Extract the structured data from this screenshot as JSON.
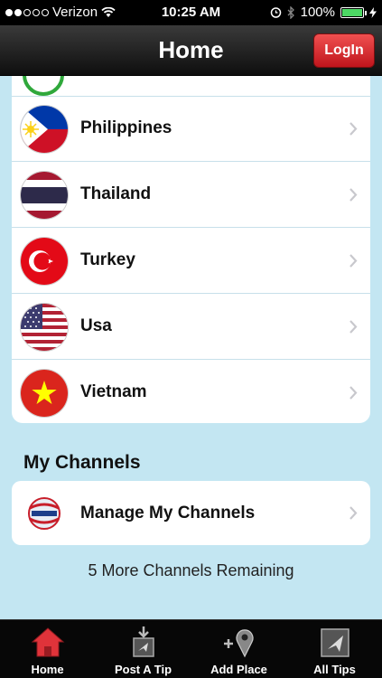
{
  "status_bar": {
    "carrier": "Verizon",
    "signal_bars": 2,
    "time": "10:25 AM",
    "battery": "100%"
  },
  "nav": {
    "title": "Home",
    "login_label": "LogIn"
  },
  "countries": [
    {
      "label": "Philippines",
      "flag": "philippines-flag-icon"
    },
    {
      "label": "Thailand",
      "flag": "thailand-flag-icon"
    },
    {
      "label": "Turkey",
      "flag": "turkey-flag-icon"
    },
    {
      "label": "Usa",
      "flag": "usa-flag-icon"
    },
    {
      "label": "Vietnam",
      "flag": "vietnam-flag-icon"
    }
  ],
  "my_channels": {
    "section_title": "My Channels",
    "manage_label": "Manage My Channels",
    "remaining_text": "5 More Channels Remaining"
  },
  "tab_bar": {
    "tabs": [
      {
        "label": "Home",
        "icon": "home-icon"
      },
      {
        "label": "Post A Tip",
        "icon": "post-tip-icon"
      },
      {
        "label": "Add Place",
        "icon": "add-place-icon"
      },
      {
        "label": "All Tips",
        "icon": "all-tips-icon"
      }
    ]
  },
  "colors": {
    "background": "#c3e6f2",
    "login_red": "#d9282e",
    "home_tab_red": "#e0333a"
  }
}
